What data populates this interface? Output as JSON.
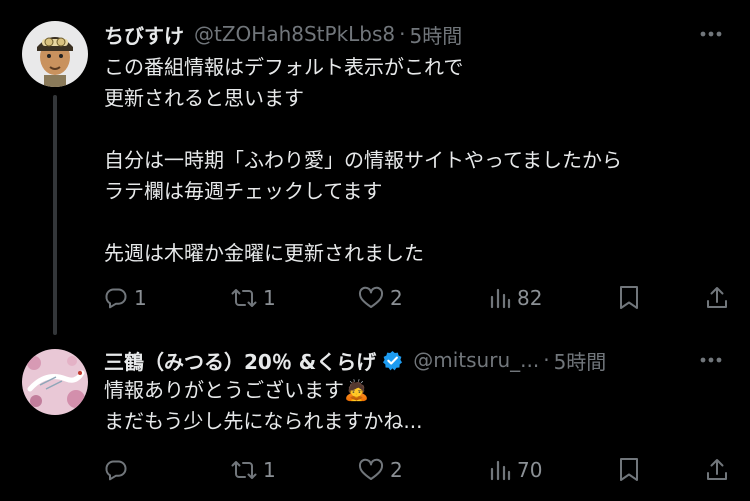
{
  "tweets": [
    {
      "display_name": "ちびすけ",
      "handle": "@tZOHah8StPkLbs8",
      "separator": "·",
      "time": "5時間",
      "verified": false,
      "text": "この番組情報はデフォルト表示がこれで\n更新されると思います\n\n自分は一時期「ふわり愛」の情報サイトやってましたから\nラテ欄は毎週チェックしてます\n\n先週は木曜か金曜に更新されました",
      "reply_count": "1",
      "retweet_count": "1",
      "like_count": "2",
      "view_count": "82"
    },
    {
      "display_name": "三鶴（みつる）20％ &くらげ",
      "handle": "@mitsuru_...",
      "separator": "·",
      "time": "5時間",
      "verified": true,
      "text": "情報ありがとうございます🙇\nまだもう少し先になられますかね...",
      "reply_count": "",
      "retweet_count": "1",
      "like_count": "2",
      "view_count": "70"
    }
  ],
  "colors": {
    "background": "#000000",
    "primary_text": "#e7e9ea",
    "secondary_text": "#71767b",
    "verified_badge": "#1d9bf0",
    "thread_line": "#333639"
  },
  "icons": {
    "more": "more-dots-icon",
    "reply": "reply-bubble-icon",
    "retweet": "retweet-icon",
    "like": "heart-icon",
    "views": "views-bar-chart-icon",
    "bookmark": "bookmark-icon",
    "share": "share-upload-icon",
    "verified": "verified-badge-icon"
  }
}
